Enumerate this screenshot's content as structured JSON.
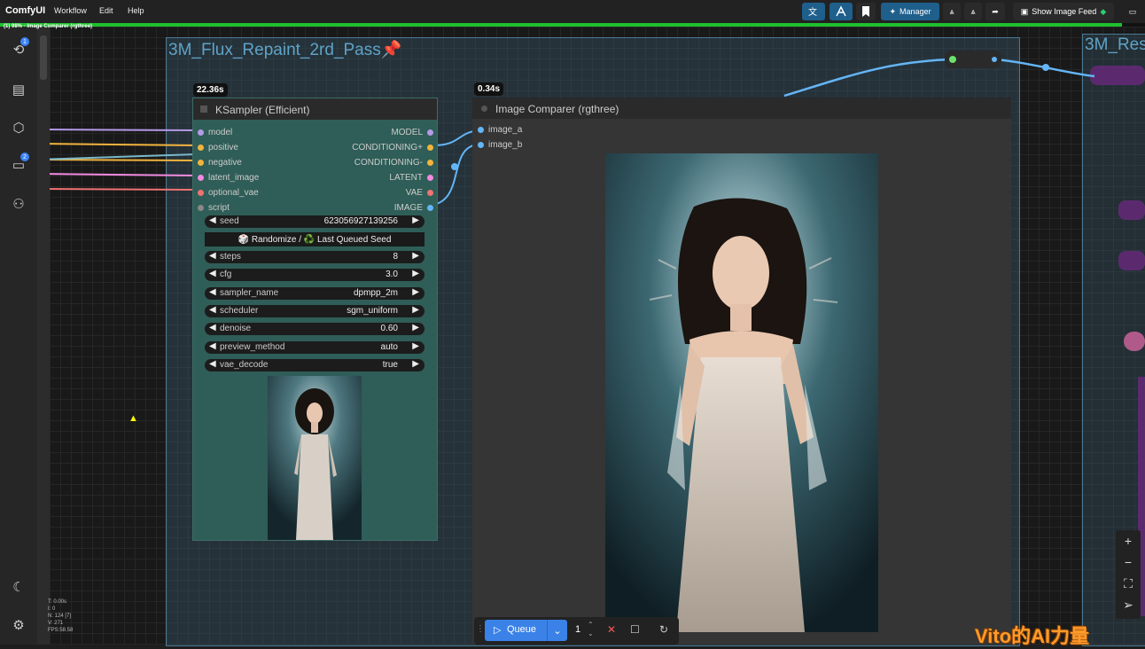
{
  "app": {
    "name": "ComfyUI",
    "menus": [
      "Workflow",
      "Edit",
      "Help"
    ],
    "manager_label": "Manager",
    "show_image_feed_label": "Show Image Feed",
    "progress_text": "(1) 98% - Image Comparer (rgthree)",
    "progress_value": 0.98
  },
  "sidebar": {
    "queue_badge": "1",
    "models_badge": "2"
  },
  "groups": [
    {
      "title": "3M_Flux_Repaint_2rd_Pass"
    },
    {
      "title": "3M_Res"
    }
  ],
  "ksampler": {
    "time": "22.36s",
    "title": "KSampler (Efficient)",
    "inputs": [
      "model",
      "positive",
      "negative",
      "latent_image",
      "optional_vae",
      "script"
    ],
    "outputs": [
      "MODEL",
      "CONDITIONING+",
      "CONDITIONING-",
      "LATENT",
      "VAE",
      "IMAGE"
    ],
    "seed_label": "seed",
    "seed_value": "623056927139256",
    "seed_button": "🎲 Randomize / ♻️ Last Queued Seed",
    "widgets": [
      {
        "label": "steps",
        "value": "8"
      },
      {
        "label": "cfg",
        "value": "3.0"
      },
      {
        "label": "sampler_name",
        "value": "dpmpp_2m"
      },
      {
        "label": "scheduler",
        "value": "sgm_uniform"
      },
      {
        "label": "denoise",
        "value": "0.60"
      },
      {
        "label": "preview_method",
        "value": "auto"
      },
      {
        "label": "vae_decode",
        "value": "true"
      }
    ]
  },
  "comparer": {
    "time": "0.34s",
    "title": "Image Comparer (rgthree)",
    "inputs": [
      "image_a",
      "image_b"
    ]
  },
  "queue": {
    "label": "Queue",
    "count": "1"
  },
  "stats": [
    "T: 0.00s",
    "I: 0",
    "N: 124 [7]",
    "V: 271",
    "FPS:58.58"
  ],
  "watermark": "Vito的AI力量",
  "colors": {
    "group_title": "#5fa3c7",
    "node_body": "#2f5d57",
    "queue_button": "#3a82e8",
    "progress": "#1fbf2f",
    "link_blue": "#64b5f6"
  }
}
